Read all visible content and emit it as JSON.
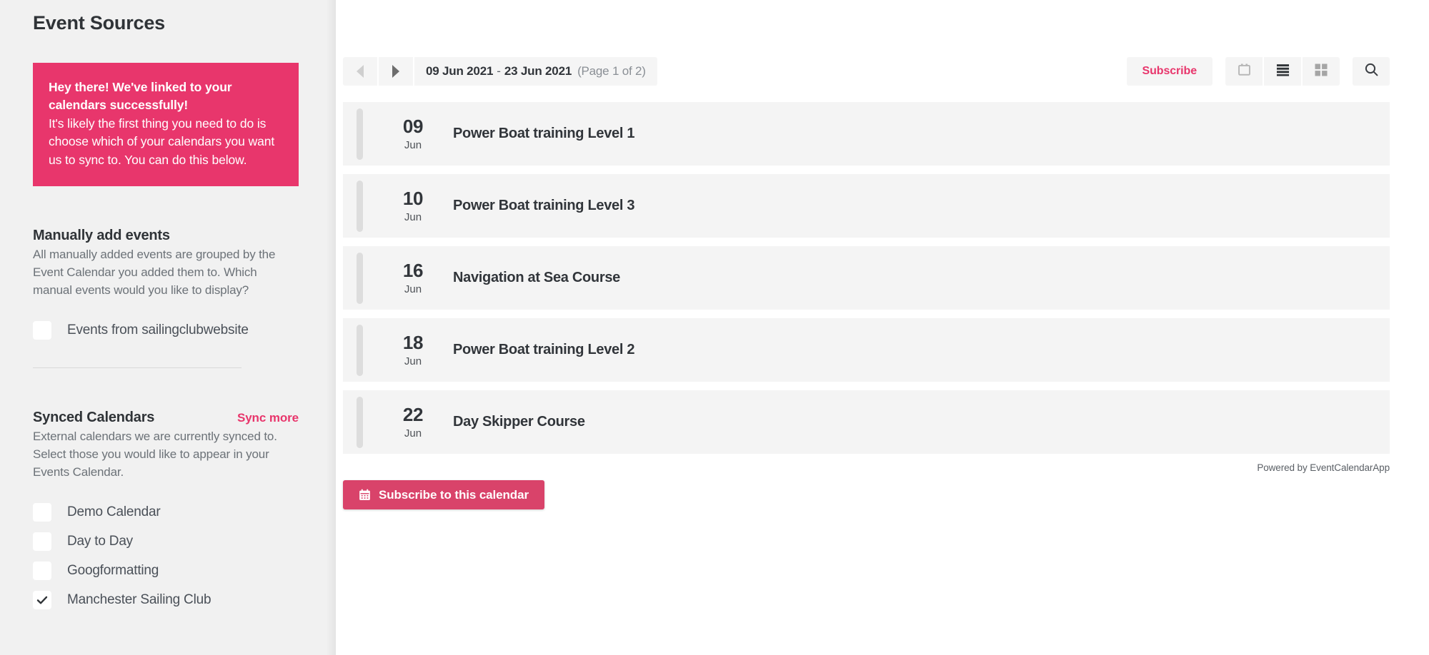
{
  "sidebar": {
    "title": "Event Sources",
    "alert": {
      "title": "Hey there! We've linked to your calendars successfully!",
      "body": "It's likely the first thing you need to do is choose which of your calendars you want us to sync to. You can do this below."
    },
    "manual": {
      "title": "Manually add events",
      "desc": "All manually added events are grouped by the Event Calendar you added them to. Which manual events would you like to display?",
      "items": [
        {
          "label": "Events from sailingclubwebsite",
          "checked": false
        }
      ]
    },
    "synced": {
      "title": "Synced Calendars",
      "link": "Sync more",
      "desc": "External calendars we are currently synced to. Select those you would like to appear in your Events Calendar.",
      "items": [
        {
          "label": "Demo Calendar",
          "checked": false
        },
        {
          "label": "Day to Day",
          "checked": false
        },
        {
          "label": "Googformatting",
          "checked": false
        },
        {
          "label": "Manchester Sailing Club",
          "checked": true
        }
      ]
    }
  },
  "main": {
    "toolbar": {
      "prev_icon": "triangle-left-icon",
      "next_icon": "triangle-right-icon",
      "date_start": "09 Jun 2021",
      "date_dash": "-",
      "date_end": "23 Jun 2021",
      "page_info": "(Page 1 of 2)",
      "subscribe_label": "Subscribe",
      "view_calendar_icon": "calendar-icon",
      "view_list_icon": "list-icon",
      "view_grid_icon": "grid-icon",
      "search_icon": "search-icon"
    },
    "events": [
      {
        "day": "09",
        "month": "Jun",
        "title": "Power Boat training Level 1"
      },
      {
        "day": "10",
        "month": "Jun",
        "title": "Power Boat training Level 3"
      },
      {
        "day": "16",
        "month": "Jun",
        "title": "Navigation at Sea Course"
      },
      {
        "day": "18",
        "month": "Jun",
        "title": "Power Boat training Level 2"
      },
      {
        "day": "22",
        "month": "Jun",
        "title": "Day Skipper Course"
      }
    ],
    "powered_by": "Powered by EventCalendarApp",
    "cta_label": "Subscribe to this calendar"
  },
  "colors": {
    "accent_pink": "#e8366c",
    "cta_pink": "#d9436a",
    "sidebar_bg": "#f1f1f1",
    "row_bg": "#f4f4f4"
  }
}
